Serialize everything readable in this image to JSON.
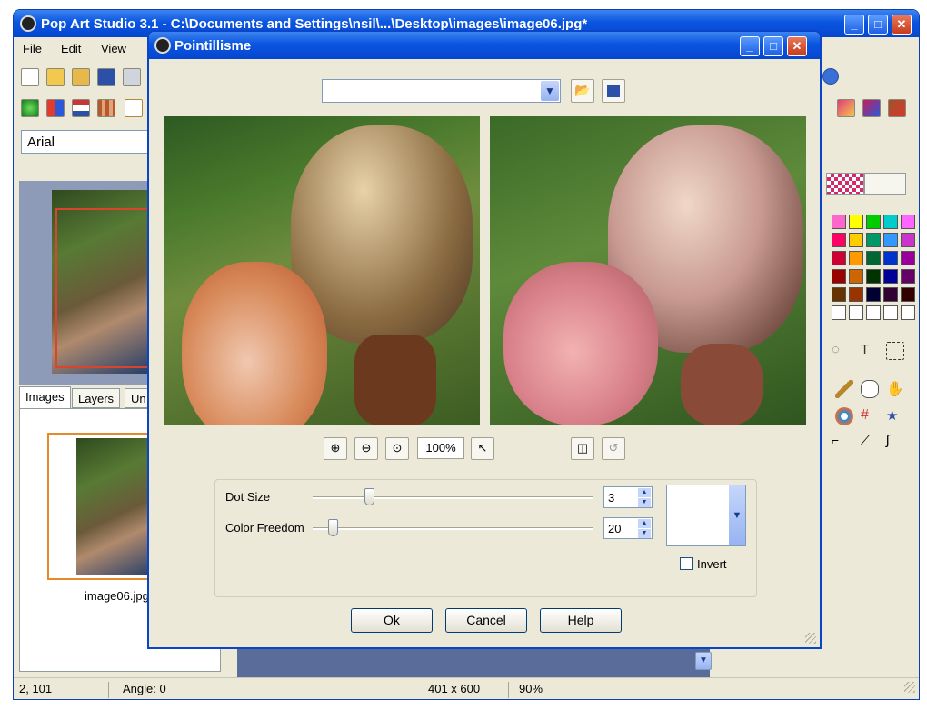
{
  "app": {
    "title": "Pop Art Studio 3.1 - C:\\Documents and Settings\\nsil\\...\\Desktop\\images\\image06.jpg*",
    "menu": [
      "File",
      "Edit",
      "View"
    ],
    "font_name": "Arial",
    "tabs": [
      "Images",
      "Layers",
      "Un"
    ],
    "thumbnail_caption": "image06.jpg",
    "palette_colors": [
      "#ff66cc",
      "#ffff00",
      "#00cc00",
      "#00cccc",
      "#ff66ff",
      "#ff0066",
      "#ffcc00",
      "#009966",
      "#3399ff",
      "#cc33cc",
      "#cc0033",
      "#ff9900",
      "#006633",
      "#0033cc",
      "#990099",
      "#990000",
      "#cc6600",
      "#003300",
      "#000099",
      "#660066",
      "#663300",
      "#993300",
      "#000033",
      "#330033",
      "#330000",
      "#ffffff",
      "#ffffff",
      "#ffffff",
      "#ffffff",
      "#ffffff"
    ]
  },
  "dialog": {
    "title": "Pointillisme",
    "preset_value": "",
    "zoom_label": "100%",
    "dot_size": {
      "label": "Dot Size",
      "value": "3",
      "level": 0.2
    },
    "color_freedom": {
      "label": "Color Freedom",
      "value": "20",
      "level": 0.07
    },
    "invert_label": "Invert",
    "ok_label": "Ok",
    "cancel_label": "Cancel",
    "help_label": "Help"
  },
  "status": {
    "coords": "2, 101",
    "angle": "Angle: 0",
    "dimensions": "401 x 600",
    "zoom": "90%"
  },
  "icons": [
    "app-icon",
    "new-icon",
    "open-icon",
    "save-icon",
    "zoom-in-icon",
    "zoom-out-icon",
    "zoom-fit-icon",
    "pointer-icon",
    "fit-icon",
    "reset-icon",
    "minimize-icon",
    "maximize-icon",
    "close-icon"
  ]
}
